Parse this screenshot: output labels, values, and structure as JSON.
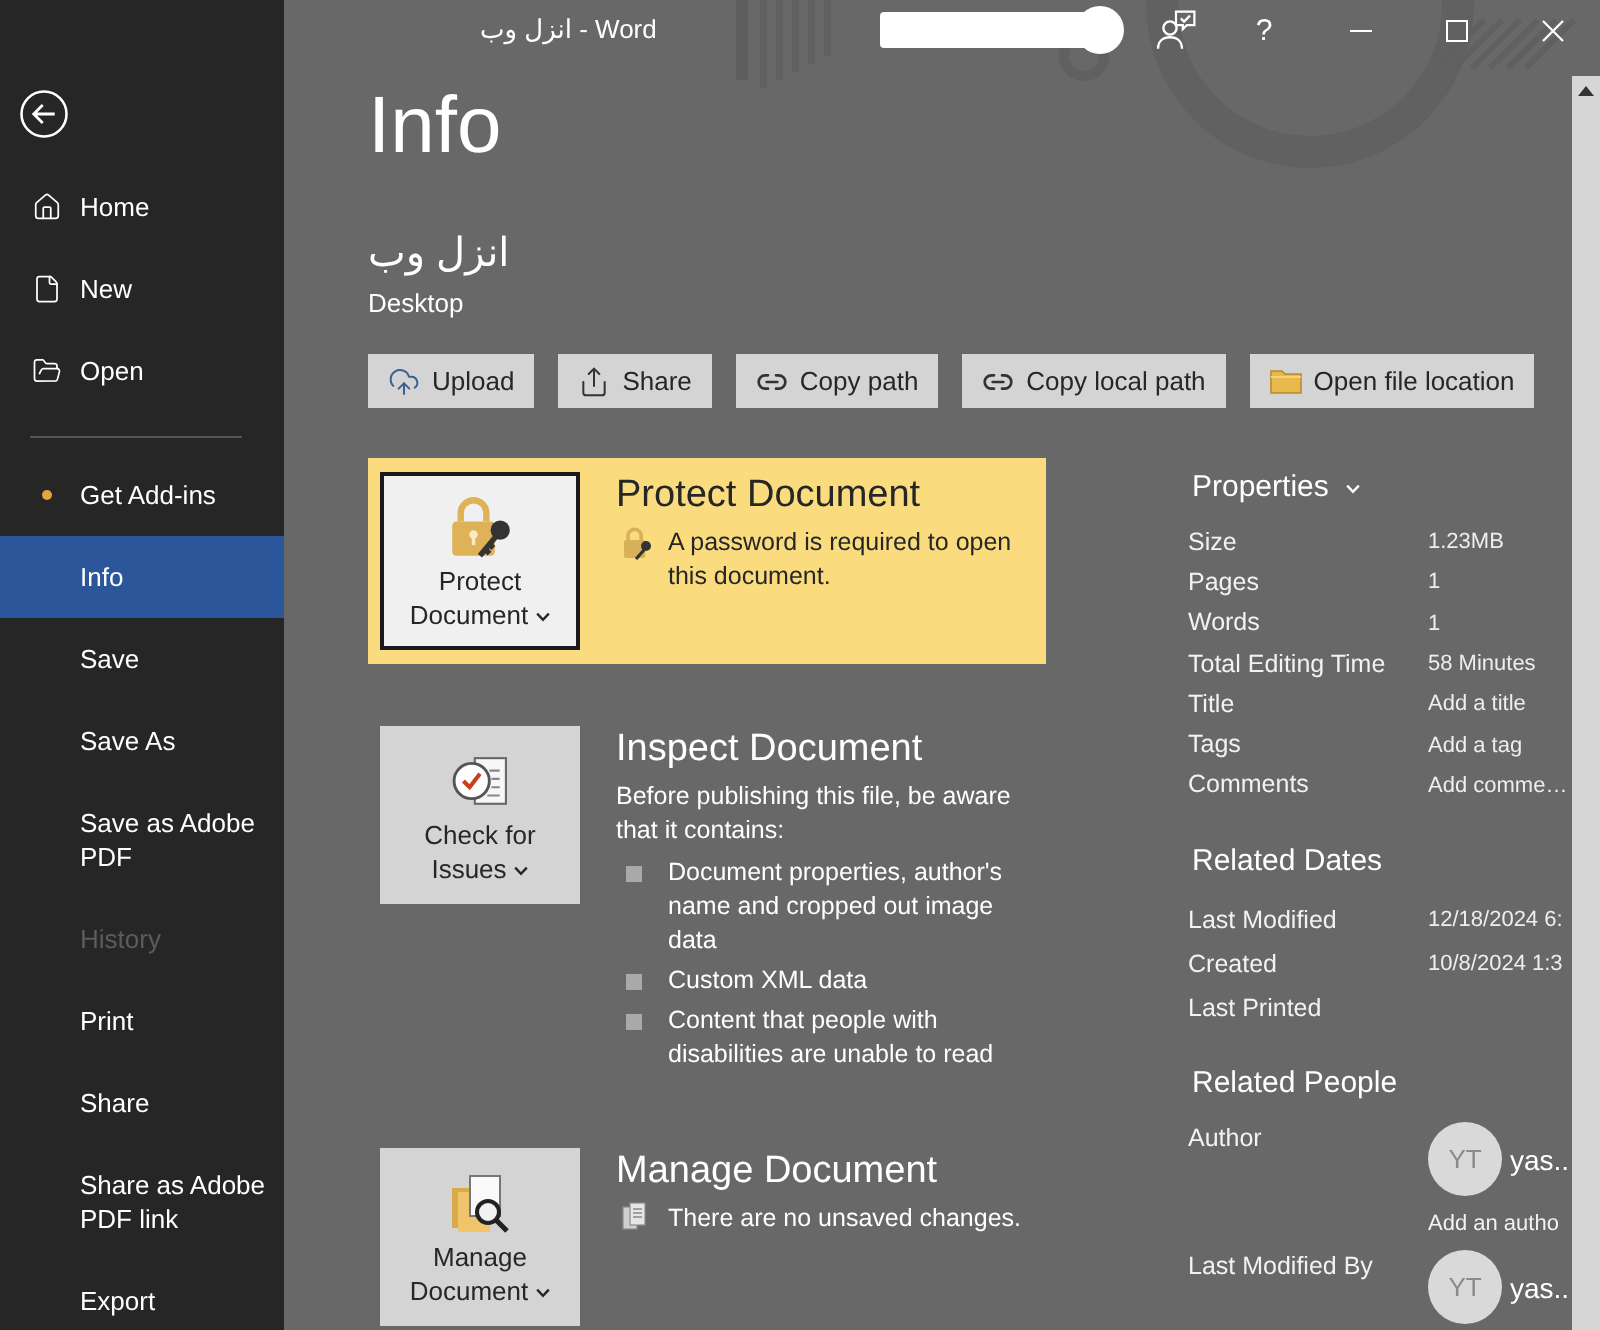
{
  "title_bar": {
    "title": "انزل وب - Word",
    "help": "?"
  },
  "sidebar": {
    "primary": [
      {
        "label": "Home",
        "selected": false
      },
      {
        "label": "New",
        "selected": false
      },
      {
        "label": "Open",
        "selected": false
      }
    ],
    "secondary": [
      {
        "label": "Get Add-ins",
        "selected": false,
        "disabled": false,
        "dot": true
      },
      {
        "label": "Info",
        "selected": true,
        "disabled": false,
        "dot": false
      },
      {
        "label": "Save",
        "selected": false,
        "disabled": false,
        "dot": false
      },
      {
        "label": "Save As",
        "selected": false,
        "disabled": false,
        "dot": false
      },
      {
        "label": "Save as Adobe PDF",
        "selected": false,
        "disabled": false,
        "dot": false
      },
      {
        "label": "History",
        "selected": false,
        "disabled": true,
        "dot": false
      },
      {
        "label": "Print",
        "selected": false,
        "disabled": false,
        "dot": false
      },
      {
        "label": "Share",
        "selected": false,
        "disabled": false,
        "dot": false
      },
      {
        "label": "Share as Adobe PDF link",
        "selected": false,
        "disabled": false,
        "dot": false
      },
      {
        "label": "Export",
        "selected": false,
        "disabled": false,
        "dot": false
      }
    ]
  },
  "header": {
    "heading": "Info",
    "document_name": "انزل وب",
    "location": "Desktop"
  },
  "actions": [
    {
      "label": "Upload"
    },
    {
      "label": "Share"
    },
    {
      "label": "Copy path"
    },
    {
      "label": "Copy local path"
    },
    {
      "label": "Open file location"
    }
  ],
  "sections": [
    {
      "kind": "protect",
      "highlighted": true,
      "button": {
        "label": "Protect Document",
        "focused": true
      },
      "title": "Protect Document",
      "description": "A password is required to open this document."
    },
    {
      "kind": "inspect",
      "highlighted": false,
      "button": {
        "label": "Check for Issues",
        "focused": false
      },
      "title": "Inspect Document",
      "description": "Before publishing this file, be aware that it contains:",
      "bullets": [
        "Document properties, author's name and cropped out image data",
        "Custom XML data",
        "Content that people with disabilities are unable to read"
      ]
    },
    {
      "kind": "manage",
      "highlighted": false,
      "button": {
        "label": "Manage Document",
        "focused": false
      },
      "title": "Manage Document",
      "description": "There are no unsaved changes."
    }
  ],
  "properties": {
    "heading": "Properties",
    "rows": [
      {
        "label": "Size",
        "value": "1.23MB"
      },
      {
        "label": "Pages",
        "value": "1"
      },
      {
        "label": "Words",
        "value": "1"
      },
      {
        "label": "Total Editing Time",
        "value": "58 Minutes"
      },
      {
        "label": "Title",
        "value": "Add a title"
      },
      {
        "label": "Tags",
        "value": "Add a tag"
      },
      {
        "label": "Comments",
        "value": "Add comme…"
      }
    ]
  },
  "related_dates": {
    "heading": "Related Dates",
    "rows": [
      {
        "label": "Last Modified",
        "value": "12/18/2024 6:"
      },
      {
        "label": "Created",
        "value": "10/8/2024 1:3"
      },
      {
        "label": "Last Printed"
      }
    ]
  },
  "related_people": {
    "heading": "Related People",
    "rows": [
      {
        "label": "Author",
        "person": {
          "initials": "YT",
          "name": "yas.."
        },
        "link": "Add an autho"
      },
      {
        "label": "Last Modified By",
        "person": {
          "initials": "YT",
          "name": "yas.."
        }
      }
    ]
  }
}
